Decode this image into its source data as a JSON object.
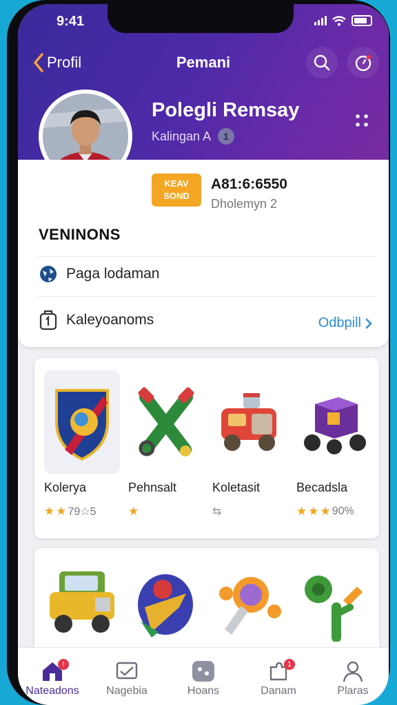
{
  "status_bar": {
    "time": "9:41"
  },
  "nav": {
    "back_label": "Profil",
    "title": "Pemani"
  },
  "profile": {
    "name": "Polegli Remsay",
    "subtitle": "Kalingan A",
    "subtitle_badge": "1"
  },
  "level": {
    "badge_line1": "KEAV",
    "badge_line2": "SOND",
    "stat_value": "A81:6:6550",
    "stat_label": "Dholemyn 2"
  },
  "section": {
    "title": "VENINONS"
  },
  "rows": {
    "row1_label": "Paga lodaman",
    "row2_label": "Kaleyoanoms",
    "row2_link": "Odbpill"
  },
  "collection": [
    {
      "label": "Kolerya",
      "rating_text": "79☆5",
      "stars": 2
    },
    {
      "label": "Pehnsalt",
      "rating_text": "",
      "stars": 1
    },
    {
      "label": "Koletasit",
      "rating_text": "",
      "stars": 0
    },
    {
      "label": "Becadsla",
      "rating_text": "90%",
      "stars": 3
    }
  ],
  "tabs": [
    {
      "label": "Nateadons",
      "icon": "home-icon",
      "badge": "!"
    },
    {
      "label": "Nagebia",
      "icon": "message-icon",
      "badge": ""
    },
    {
      "label": "Hoans",
      "icon": "game-icon",
      "badge": ""
    },
    {
      "label": "Danam",
      "icon": "puzzle-icon",
      "badge": "1"
    },
    {
      "label": "Plaras",
      "icon": "user-icon",
      "badge": ""
    }
  ],
  "colors": {
    "accent": "#4a2b9a",
    "link": "#2a8bd1",
    "level_badge": "#f3a623",
    "star": "#f1a51c"
  }
}
